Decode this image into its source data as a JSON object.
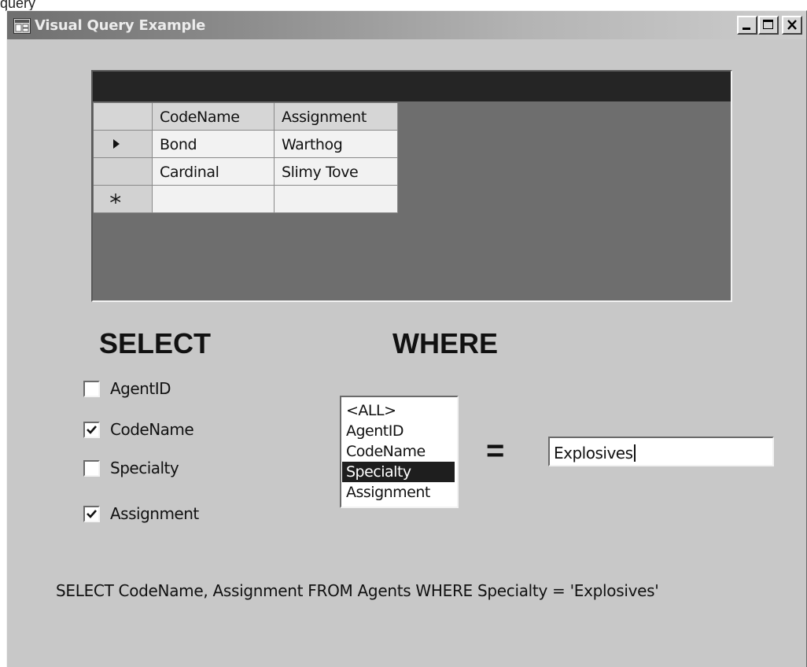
{
  "page_caption": "query",
  "window": {
    "title": "Visual Query Example",
    "icon": "app-window-icon",
    "controls": [
      {
        "name": "minimize-button",
        "icon": "minimize-icon"
      },
      {
        "name": "maximize-button",
        "icon": "maximize-icon"
      },
      {
        "name": "close-button",
        "icon": "close-icon"
      }
    ]
  },
  "grid": {
    "columns": [
      "CodeName",
      "Assignment"
    ],
    "rows": [
      {
        "marker": "current-row-arrow-icon",
        "cells": [
          "Bond",
          "Warthog"
        ]
      },
      {
        "marker": "",
        "cells": [
          "Cardinal",
          "Slimy Tove"
        ]
      },
      {
        "marker": "new-row-asterisk-icon",
        "cells": [
          "",
          ""
        ]
      }
    ]
  },
  "select_section": {
    "heading": "SELECT",
    "fields": [
      {
        "label": "AgentID",
        "checked": false
      },
      {
        "label": "CodeName",
        "checked": true
      },
      {
        "label": "Specialty",
        "checked": false
      },
      {
        "label": "Assignment",
        "checked": true
      }
    ]
  },
  "where_section": {
    "heading": "WHERE",
    "options": [
      "<ALL>",
      "AgentID",
      "CodeName",
      "Specialty",
      "Assignment"
    ],
    "selected": "Specialty",
    "operator": "=",
    "value": "Explosives"
  },
  "query_text": "SELECT CodeName, Assignment FROM Agents WHERE Specialty = 'Explosives'",
  "colors": {
    "window_bg": "#c8c8c8",
    "grid_bg": "#6e6e6e",
    "grid_caption": "#252525",
    "selection": "#1e1e1e"
  }
}
